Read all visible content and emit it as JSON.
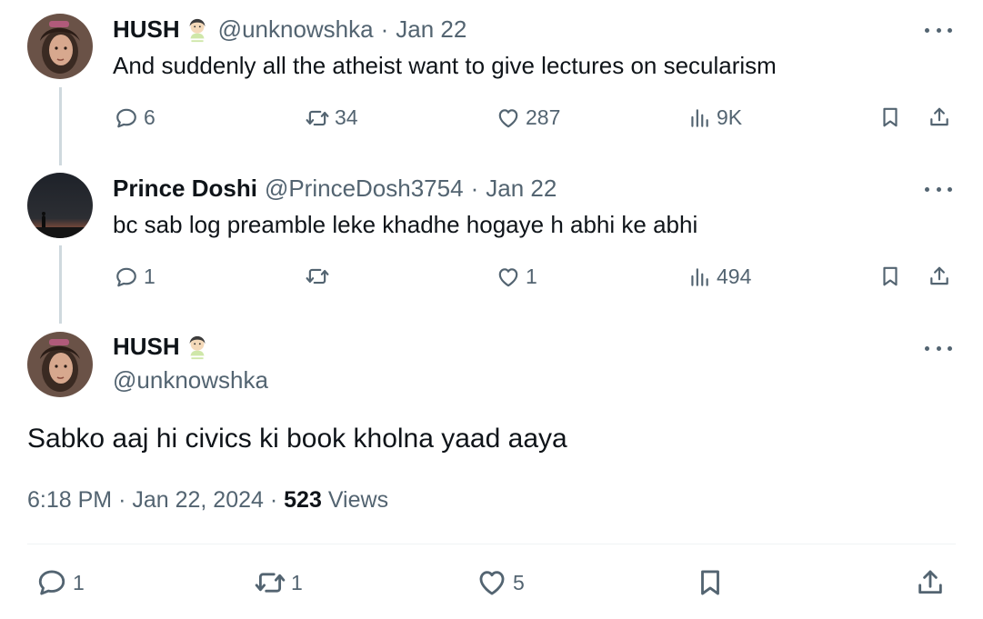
{
  "tweets": [
    {
      "name": "HUSH",
      "handle": "@unknowshka",
      "separator": "·",
      "date": "Jan 22",
      "text": "And suddenly all the atheist want to give lectures on secularism",
      "replies": "6",
      "retweets": "34",
      "likes": "287",
      "views": "9K"
    },
    {
      "name": "Prince Doshi",
      "handle": "@PrinceDosh3754",
      "separator": "·",
      "date": "Jan 22",
      "text": "bc sab log preamble leke khadhe hogaye h abhi ke abhi",
      "replies": "1",
      "retweets": "",
      "likes": "1",
      "views": "494"
    }
  ],
  "main_tweet": {
    "name": "HUSH",
    "handle": "@unknowshka",
    "text": "Sabko aaj hi civics ki book kholna yaad aaya",
    "time": "6:18 PM",
    "date": "Jan 22, 2024",
    "dot": "·",
    "views_count": "523",
    "views_label": "Views",
    "replies": "1",
    "retweets": "1",
    "likes": "5"
  },
  "icons": {
    "name_emoji": "woman-with-veil-emoji",
    "reply": "reply-icon",
    "retweet": "retweet-icon",
    "like": "heart-icon",
    "views": "views-chart-icon",
    "bookmark": "bookmark-icon",
    "share": "share-icon",
    "more": "more-dots-icon"
  },
  "colors": {
    "text": "#0f1419",
    "secondary": "#536471",
    "thread_line": "#cfd9de"
  }
}
